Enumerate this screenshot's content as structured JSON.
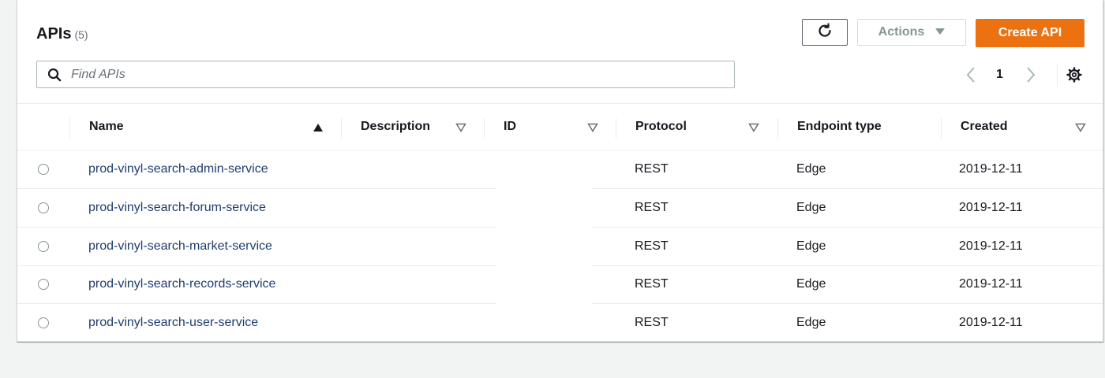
{
  "header": {
    "title": "APIs",
    "count": "(5)",
    "refresh_icon": "refresh-icon",
    "actions_label": "Actions",
    "create_label": "Create API"
  },
  "search": {
    "placeholder": "Find APIs",
    "value": ""
  },
  "pagination": {
    "current_page": "1"
  },
  "colors": {
    "accent": "#ec7211",
    "link": "#1f3d6e",
    "border": "#d5dbdb"
  },
  "table": {
    "columns": [
      "Name",
      "Description",
      "ID",
      "Protocol",
      "Endpoint type",
      "Created"
    ],
    "sort": {
      "column": "Name",
      "direction": "ascending"
    },
    "rows": [
      {
        "name": "prod-vinyl-search-admin-service",
        "description": "",
        "id": "",
        "protocol": "REST",
        "endpoint_type": "Edge",
        "created": "2019-12-11"
      },
      {
        "name": "prod-vinyl-search-forum-service",
        "description": "",
        "id": "",
        "protocol": "REST",
        "endpoint_type": "Edge",
        "created": "2019-12-11"
      },
      {
        "name": "prod-vinyl-search-market-service",
        "description": "",
        "id": "",
        "protocol": "REST",
        "endpoint_type": "Edge",
        "created": "2019-12-11"
      },
      {
        "name": "prod-vinyl-search-records-service",
        "description": "",
        "id": "",
        "protocol": "REST",
        "endpoint_type": "Edge",
        "created": "2019-12-11"
      },
      {
        "name": "prod-vinyl-search-user-service",
        "description": "",
        "id": "",
        "protocol": "REST",
        "endpoint_type": "Edge",
        "created": "2019-12-11"
      }
    ]
  }
}
